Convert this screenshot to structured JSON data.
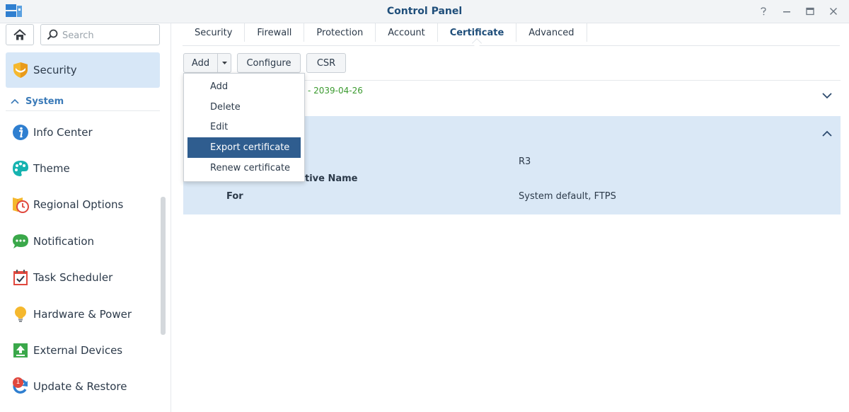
{
  "window": {
    "title": "Control Panel",
    "controls": [
      "help-icon",
      "minimize-icon",
      "maximize-icon",
      "close-icon"
    ]
  },
  "sidebar": {
    "search_placeholder": "Search",
    "selected_item": "Security",
    "group_label": "System",
    "items": [
      {
        "label": "Info Center",
        "icon": "info-icon",
        "color": "#2f7fd0"
      },
      {
        "label": "Theme",
        "icon": "palette-icon",
        "color": "#16b3b0"
      },
      {
        "label": "Regional Options",
        "icon": "regional-clock-icon",
        "color": "#f0a830"
      },
      {
        "label": "Notification",
        "icon": "chat-bubble-icon",
        "color": "#3aa84a"
      },
      {
        "label": "Task Scheduler",
        "icon": "calendar-check-icon",
        "color": "#e0483e"
      },
      {
        "label": "Hardware & Power",
        "icon": "lightbulb-icon",
        "color": "#f0b020"
      },
      {
        "label": "External Devices",
        "icon": "upload-icon",
        "color": "#3aa84a"
      },
      {
        "label": "Update & Restore",
        "icon": "refresh-icon",
        "color": "#2f7fd0",
        "badge": "1"
      }
    ]
  },
  "tabs": [
    {
      "label": "Security",
      "active": false
    },
    {
      "label": "Firewall",
      "active": false
    },
    {
      "label": "Protection",
      "active": false
    },
    {
      "label": "Account",
      "active": false
    },
    {
      "label": "Certificate",
      "active": true
    },
    {
      "label": "Advanced",
      "active": false
    }
  ],
  "toolbar": {
    "add_label": "Add",
    "configure_label": "Configure",
    "csr_label": "CSR"
  },
  "add_menu": {
    "items": [
      "Add",
      "Delete",
      "Edit",
      "Export certificate",
      "Renew certificate"
    ],
    "highlighted": "Export certificate"
  },
  "certificates": {
    "row1": {
      "date_text": "- 2039-04-26"
    },
    "row2": {
      "issuer_value": "R3",
      "alt_name_label": "tive Name",
      "for_label": "For",
      "for_value": "System default, FTPS"
    }
  },
  "colors": {
    "accent": "#1f4e7a",
    "selected_bg": "#d7e7f7",
    "menu_highlight": "#2f5d8f",
    "date_green": "#3a9a2e"
  }
}
